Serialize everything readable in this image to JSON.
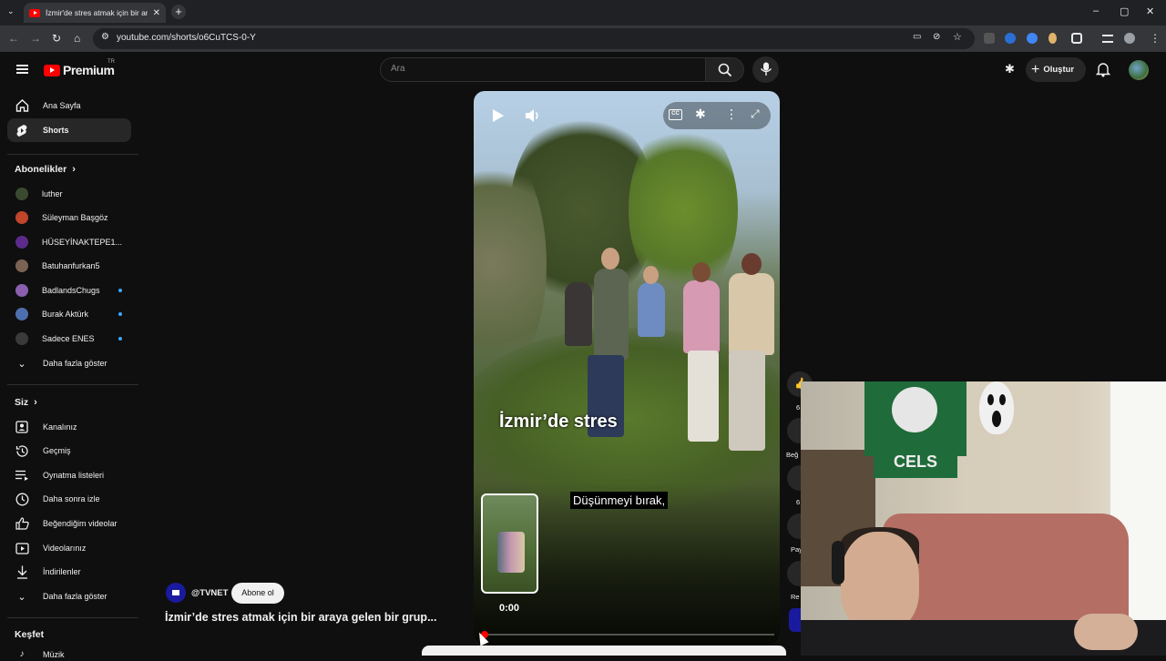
{
  "browser": {
    "tab_title": "İzmir'de stres atmak için bir araya",
    "url": "youtube.com/shorts/o6CuTCS-0-Y"
  },
  "header": {
    "logo_text": "Premium",
    "logo_country": "TR",
    "search_placeholder": "Ara",
    "create_label": "Oluştur"
  },
  "sidebar": {
    "main": [
      {
        "label": "Ana Sayfa",
        "icon": "home-icon"
      },
      {
        "label": "Shorts",
        "icon": "shorts-icon",
        "active": true
      }
    ],
    "subscriptions_heading": "Abonelikler",
    "subscriptions": [
      {
        "label": "luther",
        "avatar_color": "#3b4a2f",
        "new": false
      },
      {
        "label": "Süleyman Başgöz",
        "avatar_color": "#c0452b",
        "new": false
      },
      {
        "label": "HÜSEYİNAKTEPE1...",
        "avatar_color": "#5b2a8a",
        "new": false
      },
      {
        "label": "Batuhanfurkan5",
        "avatar_color": "#7a6353",
        "new": false
      },
      {
        "label": "BadlandsChugs",
        "avatar_color": "#8a5fb0",
        "new": true
      },
      {
        "label": "Burak Aktürk",
        "avatar_color": "#4d6fae",
        "new": true
      },
      {
        "label": "Sadece ENES",
        "avatar_color": "#3a3a3a",
        "new": true
      }
    ],
    "show_more_subs": "Daha fazla göster",
    "you_heading": "Siz",
    "you": [
      {
        "label": "Kanalınız",
        "icon": "channel-icon"
      },
      {
        "label": "Geçmiş",
        "icon": "history-icon"
      },
      {
        "label": "Oynatma listeleri",
        "icon": "playlists-icon"
      },
      {
        "label": "Daha sonra izle",
        "icon": "watch-later-icon"
      },
      {
        "label": "Beğendiğim videolar",
        "icon": "liked-icon"
      },
      {
        "label": "Videolarınız",
        "icon": "your-videos-icon"
      },
      {
        "label": "İndirilenler",
        "icon": "downloads-icon"
      }
    ],
    "show_more_you": "Daha fazla göster",
    "explore_heading": "Keşfet",
    "explore_first": "Müzik"
  },
  "short": {
    "caption_large": "İzmir’de stres",
    "caption_subtitle": "Düşünmeyi bırak,",
    "preview_time": "0:00",
    "progress": 0.0,
    "channel_handle": "@TVNET",
    "subscribe_label": "Abone ol",
    "title": "İzmir’de stres atmak için bir araya gelen bir grup..."
  },
  "rail": {
    "like_count": "6",
    "dislike_label": "Beğ",
    "comment_count": "6",
    "share_label": "Pay",
    "remix_label": "Re"
  },
  "webcam": {
    "flag_text": "CELS"
  }
}
